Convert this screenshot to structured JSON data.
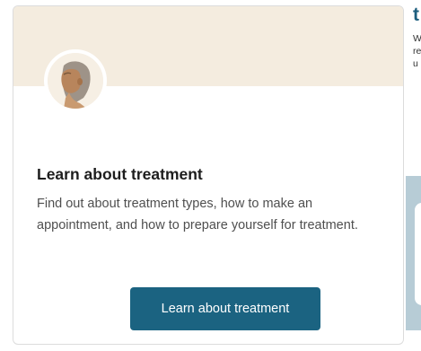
{
  "card": {
    "title": "Learn about treatment",
    "description": "Find out about treatment types, how to make an appointment, and how to prepare yourself for treatment.",
    "button_label": "Learn about treatment",
    "avatar_icon": "person-profile-icon"
  },
  "side": {
    "heading_fragment": "t",
    "text_fragments": [
      "W",
      "re",
      "u"
    ]
  },
  "colors": {
    "banner": "#f4ecdf",
    "button": "#1b6381",
    "heading_accent": "#1d5e7e",
    "side_panel": "#b7ccd6"
  }
}
